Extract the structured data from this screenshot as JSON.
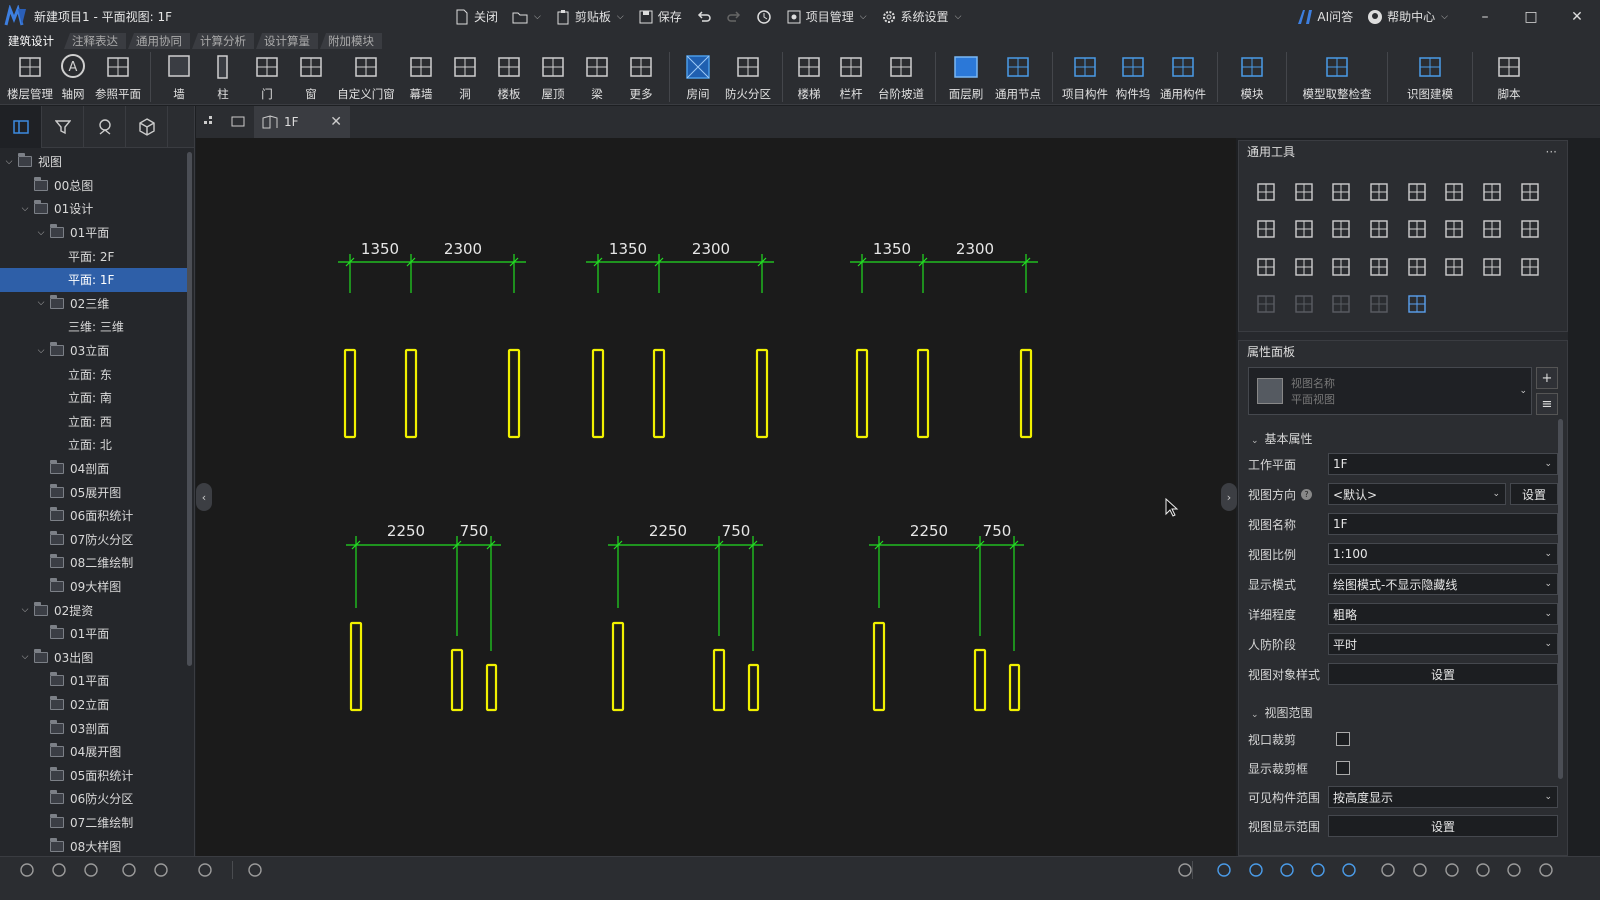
{
  "window": {
    "title": "新建项目1 - 平面视图: 1F"
  },
  "titlebar": {
    "close": "关闭",
    "clipboard": "剪贴板",
    "save": "保存",
    "project_mgmt": "项目管理",
    "system_settings": "系统设置",
    "ai": "AI问答",
    "help": "帮助中心"
  },
  "menu_tabs": [
    "建筑设计",
    "注释表达",
    "通用协同",
    "计算分析",
    "设计算量",
    "附加模块"
  ],
  "ribbon": [
    "楼层管理",
    "轴网",
    "参照平面",
    "墙",
    "柱",
    "门",
    "窗",
    "自定义门窗",
    "幕墙",
    "洞",
    "楼板",
    "屋顶",
    "梁",
    "更多",
    "房间",
    "防火分区",
    "楼梯",
    "栏杆",
    "台阶坡道",
    "面层刷",
    "通用节点",
    "项目构件",
    "构件坞",
    "通用构件",
    "模块",
    "模型取整检查",
    "识图建模",
    "脚本"
  ],
  "tree": [
    {
      "label": "视图",
      "level": 0,
      "expanded": true
    },
    {
      "label": "00总图",
      "level": 1,
      "expanded": false
    },
    {
      "label": "01设计",
      "level": 1,
      "expanded": true
    },
    {
      "label": "01平面",
      "level": 2,
      "expanded": true
    },
    {
      "label": "平面: 2F",
      "level": 3,
      "leaf": true
    },
    {
      "label": "平面: 1F",
      "level": 3,
      "leaf": true,
      "selected": true
    },
    {
      "label": "02三维",
      "level": 2,
      "expanded": true
    },
    {
      "label": "三维: 三维",
      "level": 3,
      "leaf": true
    },
    {
      "label": "03立面",
      "level": 2,
      "expanded": true
    },
    {
      "label": "立面: 东",
      "level": 3,
      "leaf": true
    },
    {
      "label": "立面: 南",
      "level": 3,
      "leaf": true
    },
    {
      "label": "立面: 西",
      "level": 3,
      "leaf": true
    },
    {
      "label": "立面: 北",
      "level": 3,
      "leaf": true
    },
    {
      "label": "04剖面",
      "level": 2
    },
    {
      "label": "05展开图",
      "level": 2
    },
    {
      "label": "06面积统计",
      "level": 2
    },
    {
      "label": "07防火分区",
      "level": 2
    },
    {
      "label": "08二维绘制",
      "level": 2
    },
    {
      "label": "09大样图",
      "level": 2
    },
    {
      "label": "02提资",
      "level": 1,
      "expanded": true
    },
    {
      "label": "01平面",
      "level": 2
    },
    {
      "label": "03出图",
      "level": 1,
      "expanded": true
    },
    {
      "label": "01平面",
      "level": 2
    },
    {
      "label": "02立面",
      "level": 2
    },
    {
      "label": "03剖面",
      "level": 2
    },
    {
      "label": "04展开图",
      "level": 2
    },
    {
      "label": "05面积统计",
      "level": 2
    },
    {
      "label": "06防火分区",
      "level": 2
    },
    {
      "label": "07二维绘制",
      "level": 2
    },
    {
      "label": "08大样图",
      "level": 2
    }
  ],
  "doc_tab": {
    "label": "1F"
  },
  "drawing": {
    "top_dims": [
      "1350",
      "2300"
    ],
    "bottom_dims": [
      "2250",
      "750"
    ],
    "colors": {
      "dim": "#22dd22",
      "element": "#f0f000"
    }
  },
  "tools_panel": {
    "title": "通用工具",
    "more": "···"
  },
  "props_panel": {
    "title": "属性面板",
    "view_selector": {
      "name_label": "视图名称",
      "type_label": "平面视图"
    },
    "sections": {
      "basic": "基本属性",
      "range": "视图范围"
    },
    "fields": {
      "work_plane": {
        "label": "工作平面",
        "value": "1F"
      },
      "view_direction": {
        "label": "视图方向",
        "value": "<默认>",
        "button": "设置"
      },
      "view_name": {
        "label": "视图名称",
        "value": "1F"
      },
      "view_scale": {
        "label": "视图比例",
        "value": "1:100"
      },
      "display_mode": {
        "label": "显示模式",
        "value": "绘图模式-不显示隐藏线"
      },
      "detail_level": {
        "label": "详细程度",
        "value": "粗略"
      },
      "civil_defense": {
        "label": "人防阶段",
        "value": "平时"
      },
      "object_style": {
        "label": "视图对象样式",
        "button": "设置"
      },
      "viewport_crop": {
        "label": "视口裁剪",
        "checked": false
      },
      "show_crop_box": {
        "label": "显示裁剪框",
        "checked": false
      },
      "visible_range": {
        "label": "可见构件范围",
        "value": "按高度显示"
      },
      "display_range": {
        "label": "视图显示范围",
        "button": "设置"
      }
    }
  }
}
